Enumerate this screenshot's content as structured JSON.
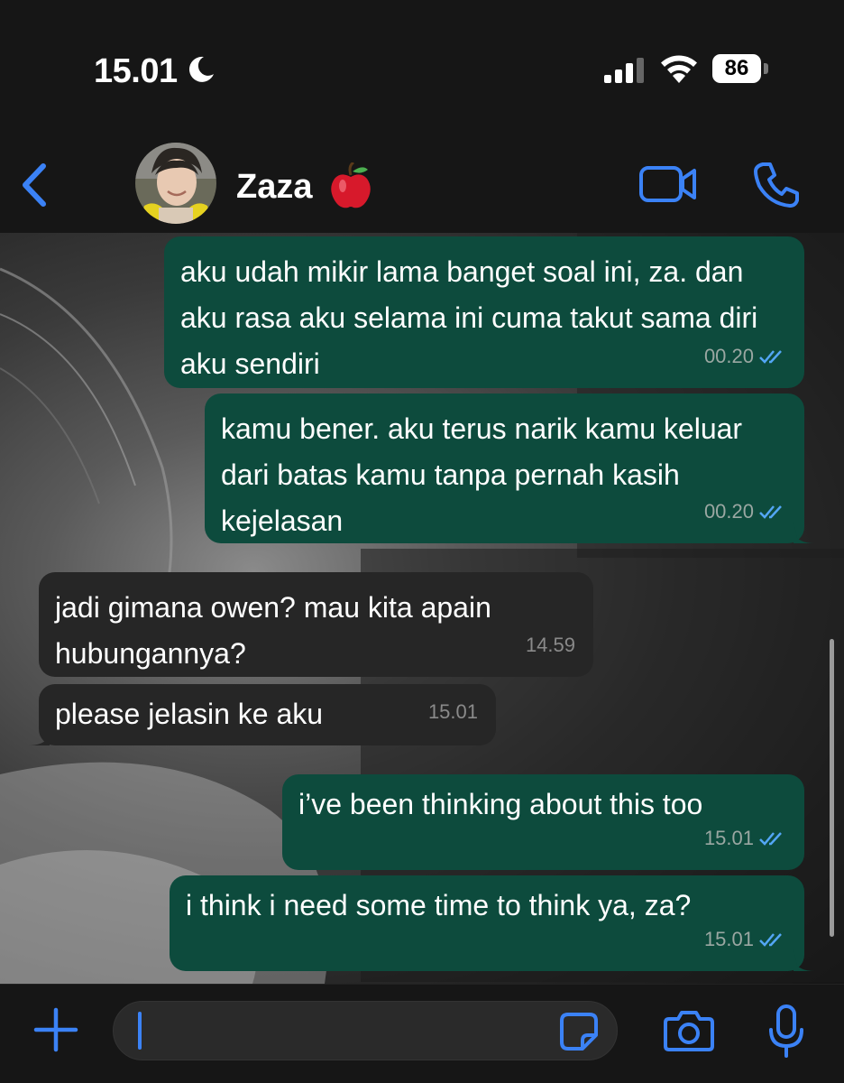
{
  "status_bar": {
    "time": "15.01",
    "battery_level": "86"
  },
  "header": {
    "contact_name": "Zaza"
  },
  "messages": [
    {
      "direction": "out",
      "text": "aku udah mikir lama banget soal ini, za. dan aku rasa aku selama ini cuma takut sama diri aku sendiri",
      "time": "00.20",
      "status": "read"
    },
    {
      "direction": "out",
      "text": "kamu bener. aku terus narik kamu keluar dari batas kamu tanpa pernah kasih kejelasan",
      "time": "00.20",
      "status": "read"
    },
    {
      "direction": "in",
      "text": "jadi gimana owen? mau kita apain hubungannya?",
      "time": "14.59"
    },
    {
      "direction": "in",
      "text": "please jelasin ke aku",
      "time": "15.01"
    },
    {
      "direction": "out",
      "text": "i’ve been thinking about this too",
      "time": "15.01",
      "status": "read"
    },
    {
      "direction": "out",
      "text": "i think i need some time to think ya, za?",
      "time": "15.01",
      "status": "read"
    }
  ],
  "input": {
    "value": ""
  },
  "colors": {
    "accent": "#3b82f6",
    "outgoing_bubble": "#0d4b3d",
    "incoming_bubble": "#262626",
    "read_ticks": "#53a6f5"
  }
}
